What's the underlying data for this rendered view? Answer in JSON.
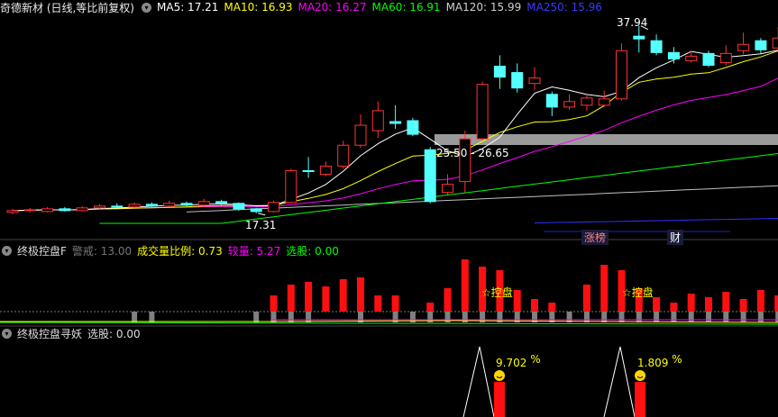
{
  "header": {
    "title": "奇德新材 (日线,等比前复权)",
    "ma5": "MA5: 17.21",
    "ma10": "MA10: 16.93",
    "ma20": "MA20: 16.27",
    "ma60": "MA60: 16.91",
    "ma120": "MA120: 15.99",
    "ma250": "MA250: 15.96"
  },
  "price_chart": {
    "high_label": "37.94",
    "low_label": "17.31",
    "range_label": "25.50 - 26.65",
    "tag_limit_up": "涨榜",
    "tag_finance": "财"
  },
  "panel2": {
    "title": "终极控盘F",
    "warn": "警戒: 13.00",
    "ratio": "成交量比例: 0.73",
    "compare": "较量: 5.27",
    "select": "选股: 0.00",
    "marker1": "☆控盘",
    "marker2": "☆控盘"
  },
  "panel3": {
    "title": "终极控盘寻妖",
    "select": "选股: 0.00",
    "pct1": "9.702",
    "pct2": "1.809",
    "pct_sign": "%"
  },
  "colors": {
    "ma5": "#ffffff",
    "ma10": "#ffff00",
    "ma20": "#ff00ff",
    "ma60": "#00ff00",
    "ma120": "#c0c0c0",
    "ma250": "#3030ff",
    "up": "#ff3232",
    "down": "#54ffff"
  },
  "chart_data": {
    "type": "candlestick",
    "candles": [
      {
        "o": 17.4,
        "c": 17.6,
        "h": 17.8,
        "l": 17.2
      },
      {
        "o": 17.6,
        "c": 17.7,
        "h": 17.9,
        "l": 17.4
      },
      {
        "o": 17.5,
        "c": 17.8,
        "h": 18.0,
        "l": 17.4
      },
      {
        "o": 17.8,
        "c": 17.6,
        "h": 18.0,
        "l": 17.5
      },
      {
        "o": 17.6,
        "c": 17.9,
        "h": 18.1,
        "l": 17.5
      },
      {
        "o": 17.9,
        "c": 18.1,
        "h": 18.3,
        "l": 17.8
      },
      {
        "o": 18.1,
        "c": 18.0,
        "h": 18.4,
        "l": 17.9
      },
      {
        "o": 18.0,
        "c": 18.3,
        "h": 18.5,
        "l": 17.9
      },
      {
        "o": 18.3,
        "c": 18.1,
        "h": 18.5,
        "l": 18.0
      },
      {
        "o": 18.1,
        "c": 18.4,
        "h": 18.7,
        "l": 18.0
      },
      {
        "o": 18.4,
        "c": 18.2,
        "h": 18.6,
        "l": 18.1
      },
      {
        "o": 18.2,
        "c": 18.6,
        "h": 18.9,
        "l": 18.1
      },
      {
        "o": 18.6,
        "c": 18.4,
        "h": 18.8,
        "l": 18.2
      },
      {
        "o": 18.4,
        "c": 17.8,
        "h": 18.5,
        "l": 17.6
      },
      {
        "o": 17.8,
        "c": 17.5,
        "h": 17.9,
        "l": 17.31
      },
      {
        "o": 17.5,
        "c": 18.5,
        "h": 18.7,
        "l": 17.4
      },
      {
        "o": 18.5,
        "c": 22.0,
        "h": 22.2,
        "l": 18.4
      },
      {
        "o": 22.0,
        "c": 21.9,
        "h": 23.5,
        "l": 21.2
      },
      {
        "o": 21.6,
        "c": 22.5,
        "h": 23.0,
        "l": 21.4
      },
      {
        "o": 22.5,
        "c": 24.8,
        "h": 25.3,
        "l": 22.2
      },
      {
        "o": 24.8,
        "c": 27.0,
        "h": 28.2,
        "l": 24.5
      },
      {
        "o": 26.4,
        "c": 28.6,
        "h": 29.6,
        "l": 25.6
      },
      {
        "o": 27.4,
        "c": 27.2,
        "h": 29.2,
        "l": 26.6
      },
      {
        "o": 27.5,
        "c": 26.0,
        "h": 27.8,
        "l": 25.8
      },
      {
        "o": 24.3,
        "c": 18.6,
        "h": 24.6,
        "l": 18.4
      },
      {
        "o": 19.6,
        "c": 20.5,
        "h": 21.6,
        "l": 19.4
      },
      {
        "o": 20.8,
        "c": 25.5,
        "h": 26.4,
        "l": 19.6
      },
      {
        "o": 25.5,
        "c": 31.5,
        "h": 31.8,
        "l": 25.3
      },
      {
        "o": 33.5,
        "c": 32.3,
        "h": 34.7,
        "l": 31.0
      },
      {
        "o": 32.8,
        "c": 31.1,
        "h": 33.8,
        "l": 30.6
      },
      {
        "o": 31.6,
        "c": 32.2,
        "h": 33.4,
        "l": 30.9
      },
      {
        "o": 30.4,
        "c": 29.0,
        "h": 30.7,
        "l": 28.0
      },
      {
        "o": 29.0,
        "c": 29.6,
        "h": 30.4,
        "l": 28.7
      },
      {
        "o": 29.2,
        "c": 30.0,
        "h": 30.4,
        "l": 28.6
      },
      {
        "o": 29.2,
        "c": 29.9,
        "h": 30.8,
        "l": 29.0
      },
      {
        "o": 29.9,
        "c": 35.2,
        "h": 36.0,
        "l": 29.7
      },
      {
        "o": 36.8,
        "c": 36.5,
        "h": 37.94,
        "l": 35.0
      },
      {
        "o": 36.3,
        "c": 35.0,
        "h": 37.0,
        "l": 34.7
      },
      {
        "o": 35.0,
        "c": 34.3,
        "h": 35.6,
        "l": 33.8
      },
      {
        "o": 34.1,
        "c": 34.6,
        "h": 35.2,
        "l": 33.9
      },
      {
        "o": 34.9,
        "c": 33.6,
        "h": 35.2,
        "l": 33.4
      },
      {
        "o": 33.9,
        "c": 34.9,
        "h": 35.8,
        "l": 33.6
      },
      {
        "o": 35.2,
        "c": 35.9,
        "h": 37.2,
        "l": 34.8
      },
      {
        "o": 36.3,
        "c": 35.3,
        "h": 36.6,
        "l": 34.8
      },
      {
        "o": 35.5,
        "c": 36.6,
        "h": 37.8,
        "l": 35.0
      },
      {
        "o": 36.3,
        "c": 35.0,
        "h": 36.5,
        "l": 33.8
      }
    ]
  }
}
